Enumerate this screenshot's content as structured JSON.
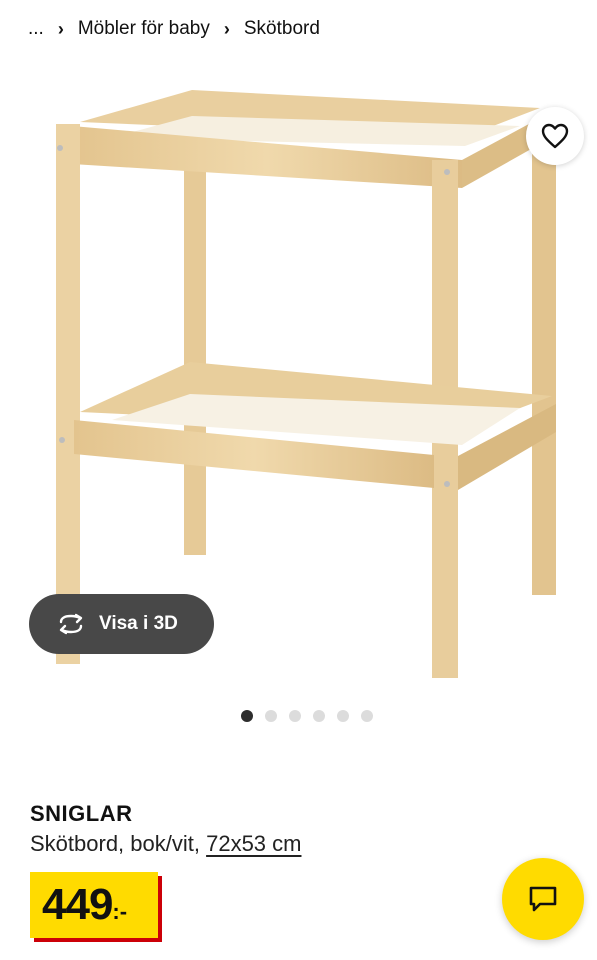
{
  "breadcrumb": {
    "ellipsis": "...",
    "items": [
      {
        "label": "Möbler för baby"
      },
      {
        "label": "Skötbord"
      }
    ]
  },
  "gallery": {
    "image_description_icon": "changing-table-image",
    "favorite_icon": "heart-icon",
    "view3d": {
      "label": "Visa i 3D",
      "icon": "rotate-3d-icon"
    },
    "dots_total": 6,
    "dots_active_index": 0
  },
  "product": {
    "name": "SNIGLAR",
    "description": "Skötbord, bok/vit, ",
    "size_link": "72x53 cm",
    "price": {
      "integer": "449",
      "decimal": ":-"
    }
  },
  "chat": {
    "icon": "chat-icon"
  },
  "colors": {
    "price_yellow": "#ffdb00",
    "price_red": "#cc0008",
    "view3d_bg": "#484848",
    "wood": "#e8cfa0"
  }
}
